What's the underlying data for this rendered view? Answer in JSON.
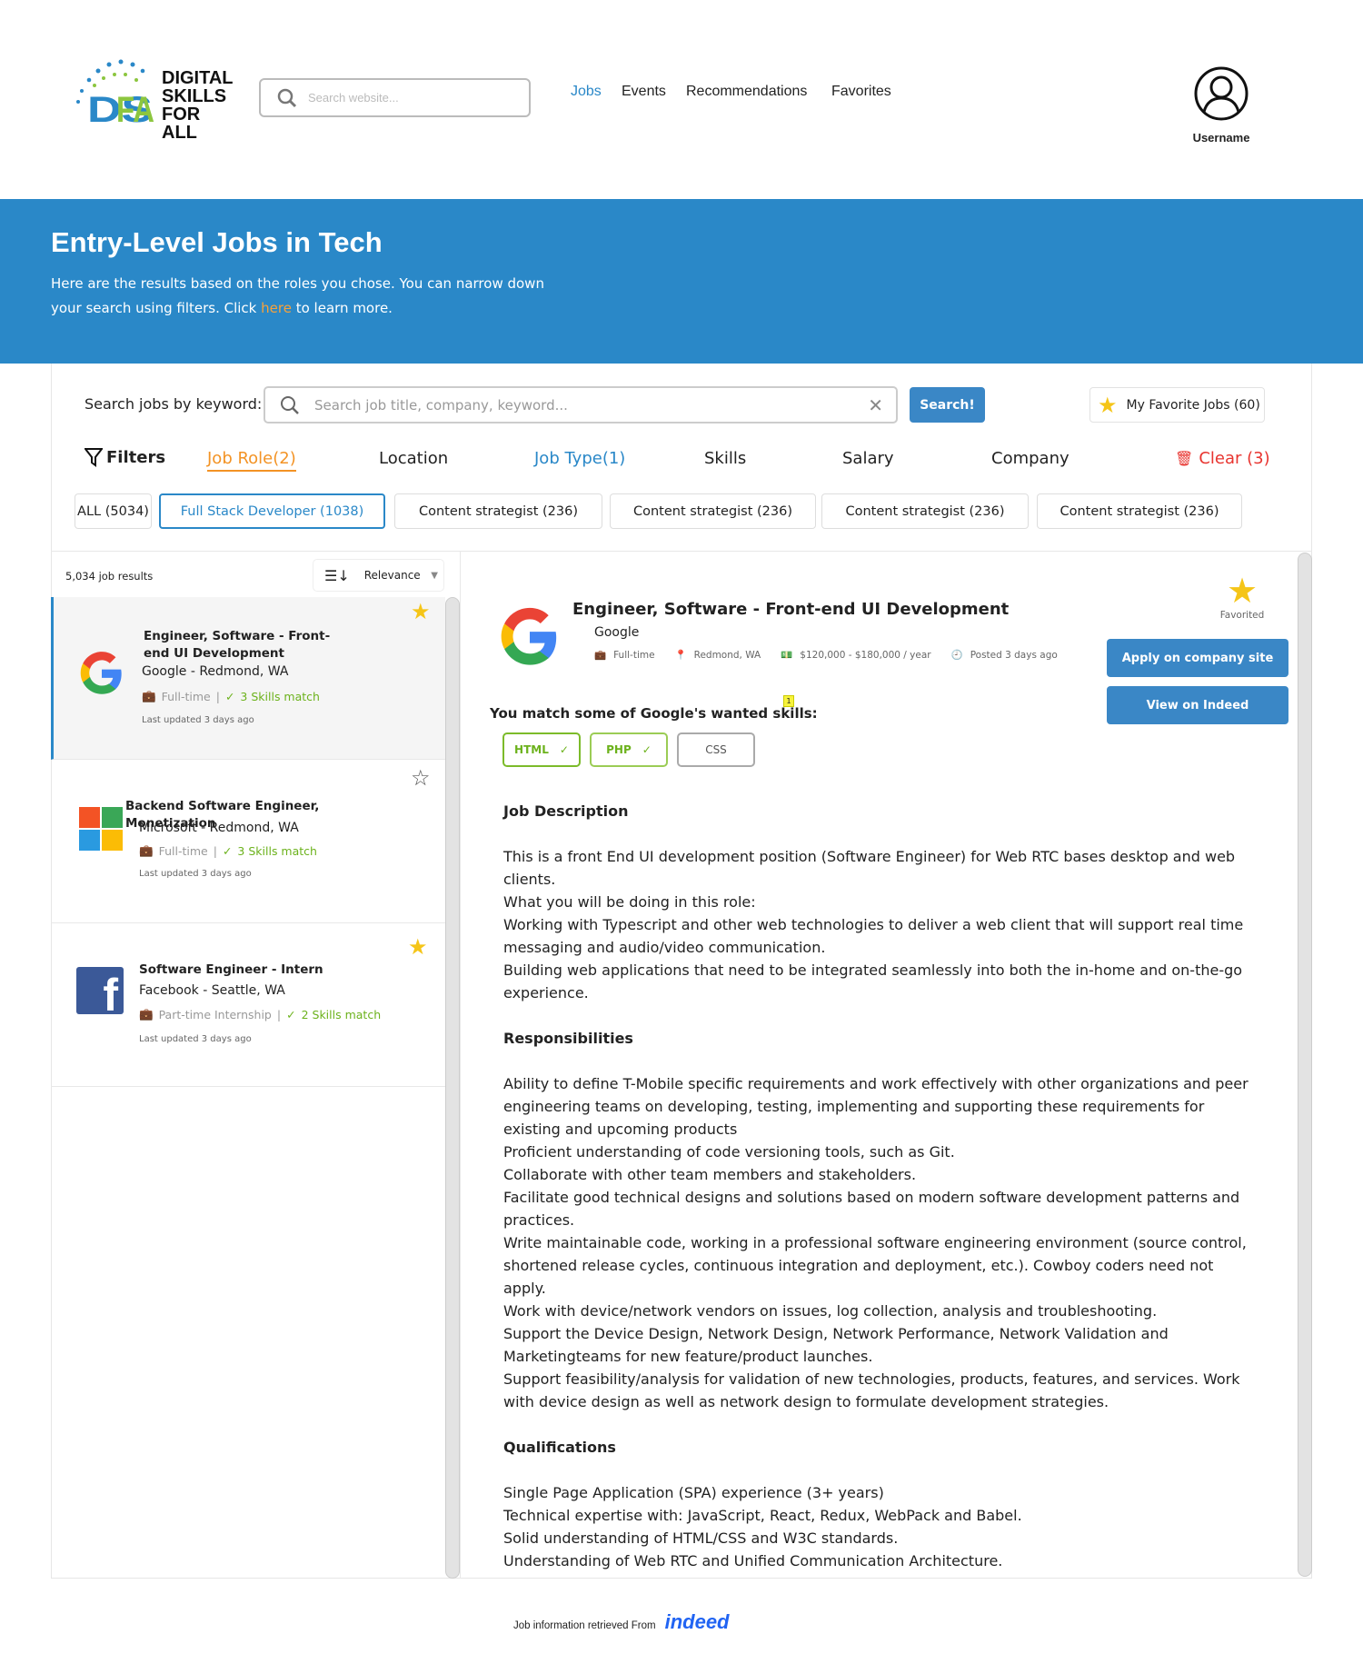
{
  "header": {
    "logo_text": "DIGITAL SKILLS FOR ALL",
    "logo_mark": "DSFA",
    "search_placeholder": "Search website...",
    "nav": [
      {
        "label": "Jobs",
        "active": true
      },
      {
        "label": "Events"
      },
      {
        "label": "Recommendations"
      },
      {
        "label": "Favorites"
      }
    ],
    "username": "Username"
  },
  "banner": {
    "title": "Entry-Level Jobs in Tech",
    "text_before": "Here are the results based on the roles you chose. You can narrow down your search using filters. Click ",
    "link": "here",
    "text_after": " to learn more."
  },
  "search": {
    "label": "Search jobs by keyword:",
    "placeholder": "Search job title, company, keyword...",
    "button": "Search!",
    "favorites": "My Favorite Jobs (60)"
  },
  "filters": {
    "label": "Filters",
    "tabs": [
      "Job Role(2)",
      "Location",
      "Job Type(1)",
      "Skills",
      "Salary",
      "Company"
    ],
    "clear": "Clear (3)",
    "chips": [
      "ALL (5034)",
      "Full Stack Developer (1038)",
      "Content strategist (236)",
      "Content strategist (236)",
      "Content strategist (236)",
      "Content strategist (236)"
    ]
  },
  "list": {
    "count": "5,034 job results",
    "sort": "Relevance",
    "jobs": [
      {
        "title": "Engineer, Software - Front-end UI Development",
        "company": "Google - Redmond, WA",
        "type": "Full-time",
        "skills": "3 Skills match",
        "updated": "Last updated 3 days ago",
        "favorite": true
      },
      {
        "title": "Backend Software Engineer, Monetization",
        "company": "Microsoft - Redmond, WA",
        "type": "Full-time",
        "skills": "3 Skills match",
        "updated": "Last updated 3 days ago",
        "favorite": false
      },
      {
        "title": "Software Engineer - Intern",
        "company": "Facebook - Seattle, WA",
        "type": "Part-time Internship",
        "skills": "2 Skills match",
        "updated": "Last updated 3 days ago",
        "favorite": true
      }
    ]
  },
  "detail": {
    "title": "Engineer, Software - Front-end UI Development",
    "company": "Google",
    "type": "Full-time",
    "location": "Redmond, WA",
    "salary": "$120,000 - $180,000 / year",
    "posted": "Posted 3 days ago",
    "favorited": "Favorited",
    "apply": "Apply on company site",
    "indeed": "View on Indeed",
    "skills_heading": "You match some of Google's wanted skills:",
    "badge": "1",
    "skills": [
      {
        "name": "HTML",
        "match": true
      },
      {
        "name": "PHP",
        "match": true
      },
      {
        "name": "CSS",
        "match": false
      }
    ],
    "desc_heading": "Job Description",
    "desc": [
      "This is a front End UI development position (Software Engineer) for Web RTC bases desktop and web clients.",
      "What you will be doing in this role:",
      "Working with Typescript and other web technologies to deliver a web client that will support real time messaging and audio/video communication.",
      "Building web applications that need to be integrated seamlessly into both the in-home and on-the-go experience."
    ],
    "resp_heading": "Responsibilities",
    "resp": [
      "Ability to define T-Mobile specific requirements and work effectively with other organizations and peer engineering teams on developing, testing, implementing and supporting these requirements for existing and upcoming products",
      "Proficient understanding of code versioning tools, such as Git.",
      "Collaborate with other team members and stakeholders.",
      "Facilitate good technical designs and solutions based on modern software development patterns and practices.",
      "Write maintainable code, working in a professional software engineering environment (source control, shortened release cycles, continuous integration and deployment, etc.). Cowboy coders need not apply.",
      "Work with device/network vendors on issues, log collection, analysis and troubleshooting.",
      "Support the Device Design, Network Design, Network Performance, Network Validation and Marketingteams for new feature/product launches.",
      "Support feasibility/analysis for validation of new technologies, products, features, and services. Work with device design as well as network design to formulate development strategies."
    ],
    "qual_heading": "Qualifications",
    "qual": [
      "Single Page Application (SPA) experience (3+ years)",
      "Technical expertise with: JavaScript, React, Redux, WebPack and Babel.",
      "Solid understanding of HTML/CSS and W3C standards.",
      "Understanding of Web RTC and Unified Communication Architecture."
    ]
  },
  "footer": {
    "text": "Job information retrieved From",
    "brand": "indeed"
  }
}
